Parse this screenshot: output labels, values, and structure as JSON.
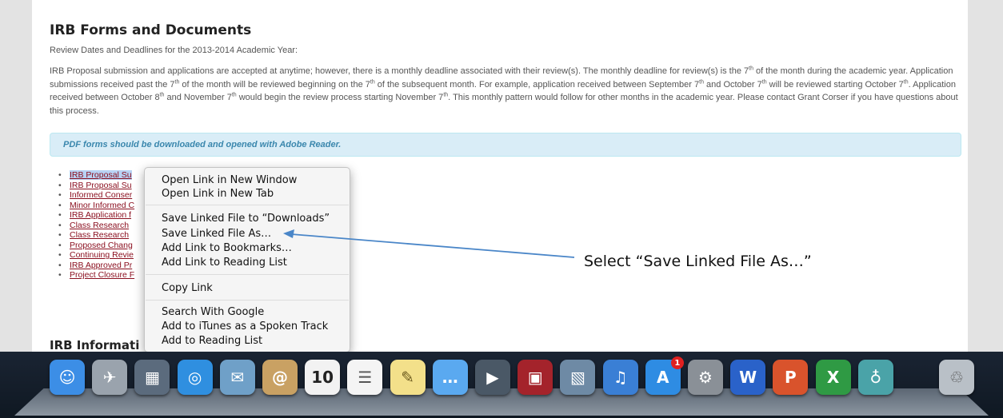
{
  "page": {
    "title": "IRB Forms and Documents",
    "subtitle": "Review Dates and Deadlines for the 2013-2014 Academic Year:",
    "paragraph": {
      "p1": "IRB Proposal submission and applications are accepted at anytime; however, there is a monthly deadline associated with their review(s). The monthly deadline for review(s) is the 7",
      "p2": " of the month during the academic year. Application submissions received past the 7",
      "p3": " of the month will be reviewed beginning on the 7",
      "p4": " of the subsequent month. For example, application received between September 7",
      "p5": " and October 7",
      "p6": " will be reviewed starting October 7",
      "p7": ". Application received between October 8",
      "p8": " and November 7",
      "p9": " would begin the review process starting November 7",
      "p10": ". This monthly pattern would follow for other months in the academic year. Please contact Grant Corser if you have questions about this process.",
      "ordinal": "th"
    },
    "notice": "PDF forms should be downloaded and opened with Adobe Reader.",
    "documents": [
      "IRB Proposal Su",
      "IRB Proposal Su",
      "Informed Conser",
      "Minor Informed C",
      "IRB Application f",
      "Class Research",
      "Class Research",
      "Proposed Chang",
      "Continuing Revie",
      "IRB Approved Pr",
      "Project Closure F"
    ],
    "section_title": "IRB Informati"
  },
  "context_menu": {
    "items": [
      "Open Link in New Window",
      "Open Link in New Tab",
      "Save Linked File to “Downloads”",
      "Save Linked File As…",
      "Add Link to Bookmarks…",
      "Add Link to Reading List",
      "Copy Link",
      "Search With Google",
      "Add to iTunes as a Spoken Track",
      "Add to Reading List"
    ]
  },
  "annotation": {
    "label": "Select “Save Linked File As…”"
  },
  "dock": {
    "apps": [
      {
        "icon": "finder-icon",
        "color": "#3c8ee6",
        "glyph": "☺"
      },
      {
        "icon": "launchpad-icon",
        "color": "#9aa3ad",
        "glyph": "✈"
      },
      {
        "icon": "mission-control-icon",
        "color": "#5b6b7d",
        "glyph": "▦"
      },
      {
        "icon": "safari-icon",
        "color": "#2f8fe0",
        "glyph": "◎"
      },
      {
        "icon": "mail-icon",
        "color": "#6fa0c8",
        "glyph": "✉"
      },
      {
        "icon": "contacts-icon",
        "color": "#c9a163",
        "glyph": "@"
      },
      {
        "icon": "calendar-icon",
        "color": "#f2f2f2",
        "glyph": "10",
        "text_color": "#222"
      },
      {
        "icon": "reminders-icon",
        "color": "#f4f4f4",
        "glyph": "☰",
        "text_color": "#555"
      },
      {
        "icon": "notes-icon",
        "color": "#f3e08a",
        "glyph": "✎",
        "text_color": "#6b5a1e"
      },
      {
        "icon": "messages-icon",
        "color": "#5aa9f0",
        "glyph": "…"
      },
      {
        "icon": "facetime-icon",
        "color": "#4a5866",
        "glyph": "▶"
      },
      {
        "icon": "photo-booth-icon",
        "color": "#a4232b",
        "glyph": "▣"
      },
      {
        "icon": "iphoto-icon",
        "color": "#6e8aa5",
        "glyph": "▧"
      },
      {
        "icon": "itunes-icon",
        "color": "#3a7fd5",
        "glyph": "♫"
      },
      {
        "icon": "app-store-icon",
        "color": "#2e8ce3",
        "glyph": "A",
        "badge": "1"
      },
      {
        "icon": "system-preferences-icon",
        "color": "#8a9097",
        "glyph": "⚙"
      },
      {
        "icon": "word-icon",
        "color": "#2a62c9",
        "glyph": "W"
      },
      {
        "icon": "powerpoint-icon",
        "color": "#d9532c",
        "glyph": "P"
      },
      {
        "icon": "excel-icon",
        "color": "#2f9a44",
        "glyph": "X"
      },
      {
        "icon": "network-icon",
        "color": "#4aa3a8",
        "glyph": "♁"
      },
      {
        "icon": "trash-icon",
        "color": "#b9c0c7",
        "glyph": "♲",
        "text_color": "#555"
      }
    ]
  }
}
